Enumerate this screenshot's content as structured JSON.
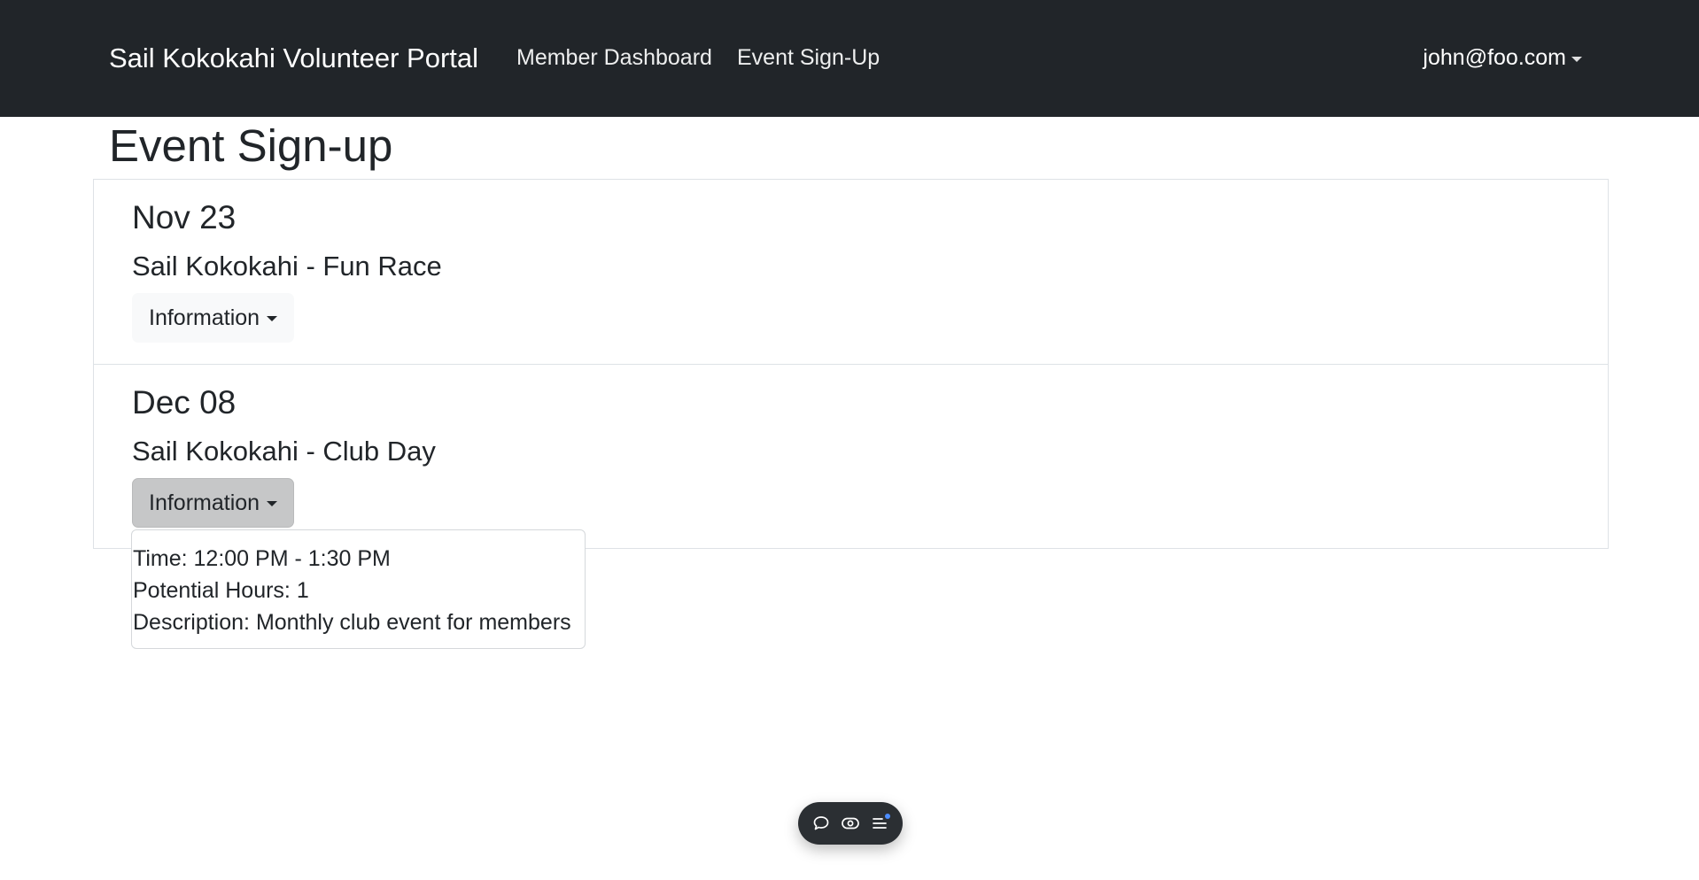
{
  "navbar": {
    "brand": "Sail Kokokahi Volunteer Portal",
    "links": [
      {
        "label": "Member Dashboard"
      },
      {
        "label": "Event Sign-Up"
      }
    ],
    "user_email": "john@foo.com",
    "background_color": "#212529"
  },
  "page": {
    "title": "Event Sign-up"
  },
  "events": [
    {
      "date": "Nov 23",
      "name": "Sail Kokokahi - Fun Race",
      "button_label": "Information"
    },
    {
      "date": "Dec 08",
      "name": "Sail Kokokahi - Club Day",
      "button_label": "Information",
      "expanded": true,
      "details": {
        "time": "Time: 12:00 PM - 1:30 PM",
        "hours": "Potential Hours: 1",
        "description": "Description: Monthly club event for members"
      }
    }
  ],
  "toolbar": {
    "icons": [
      "chat-icon",
      "eye-icon",
      "menu-icon"
    ],
    "notification_dot_color": "#4c8dff"
  }
}
